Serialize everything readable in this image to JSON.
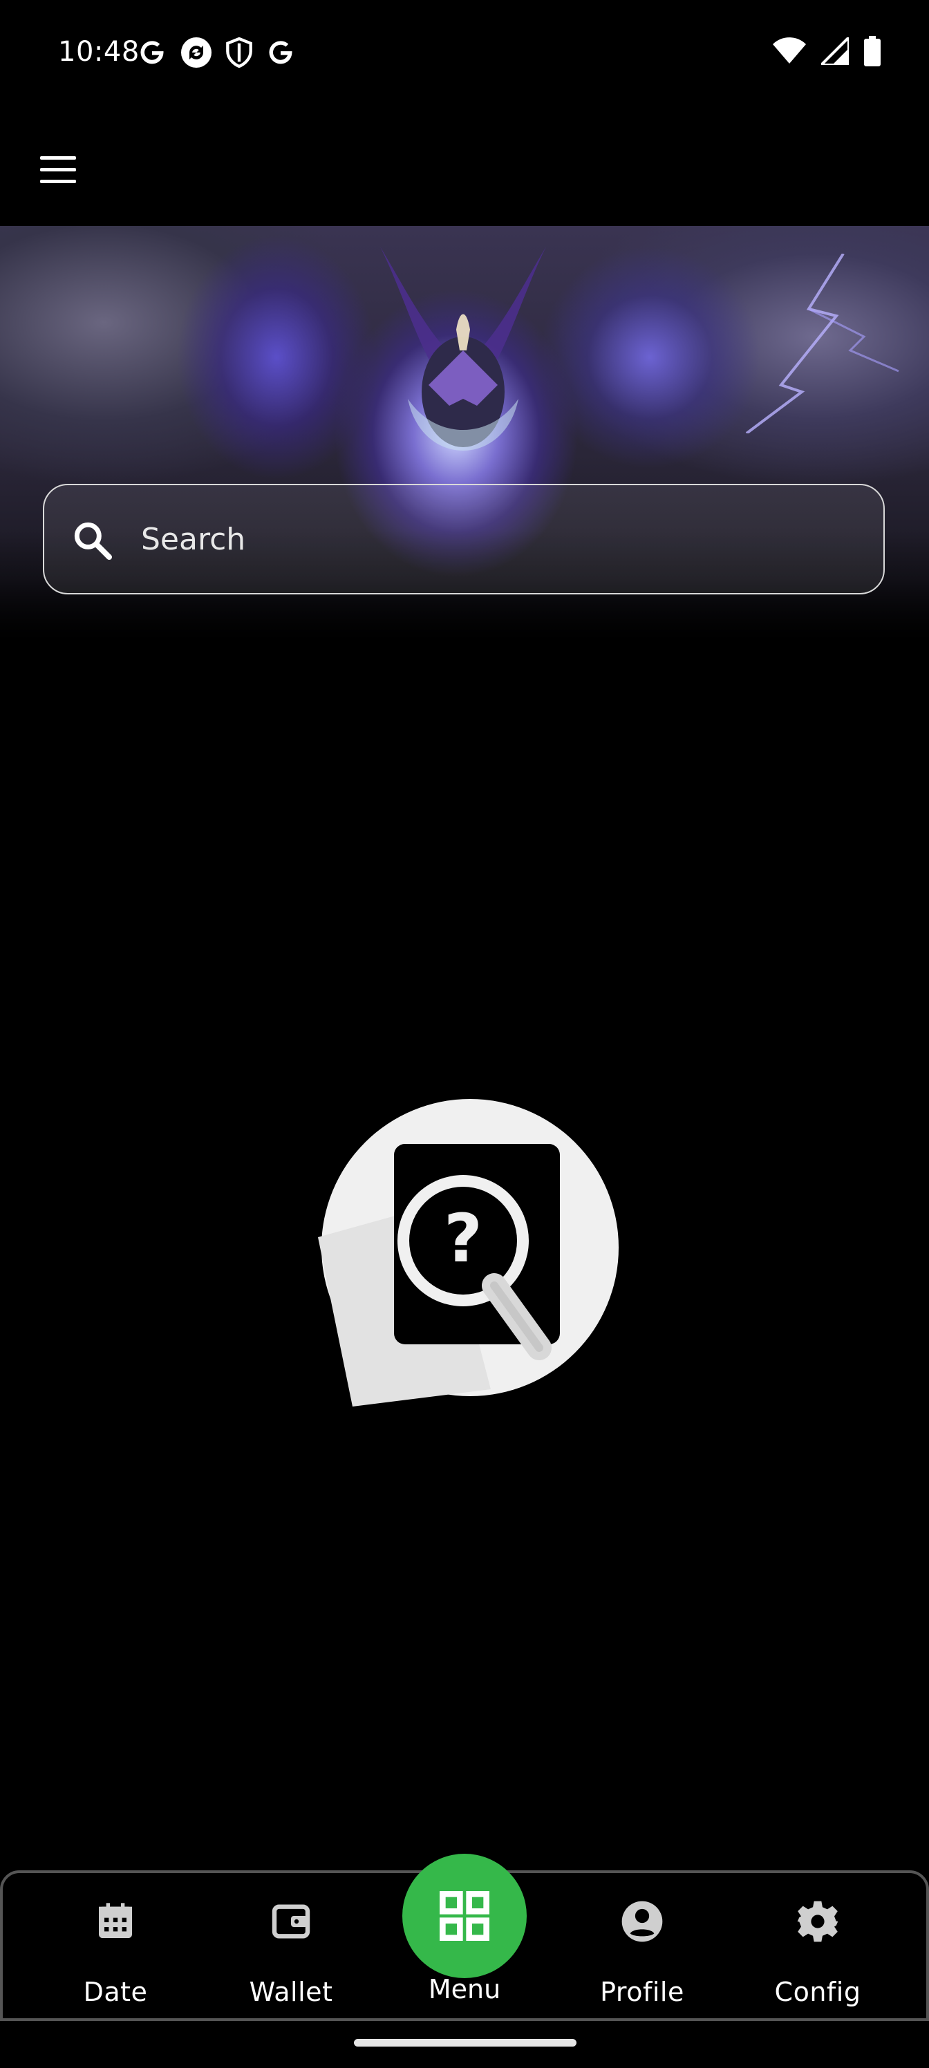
{
  "status_bar": {
    "time": "10:48",
    "left_icons": [
      "google-icon",
      "sync-icon",
      "shield-icon",
      "google-icon"
    ],
    "right_icons": [
      "wifi-icon",
      "signal-icon",
      "battery-icon"
    ]
  },
  "header": {
    "menu_icon": "hamburger-icon"
  },
  "search": {
    "placeholder": "Search"
  },
  "empty_state": {
    "icon": "document-search-question-icon"
  },
  "bottom_nav": {
    "items": [
      {
        "label": "Date",
        "icon": "calendar-icon"
      },
      {
        "label": "Wallet",
        "icon": "wallet-icon"
      },
      {
        "label": "Menu",
        "icon": "grid-icon",
        "active": true
      },
      {
        "label": "Profile",
        "icon": "account-circle-icon"
      },
      {
        "label": "Config",
        "icon": "gear-icon"
      }
    ]
  },
  "colors": {
    "accent": "#35b84a",
    "background": "#000000",
    "text": "#ffffff"
  }
}
